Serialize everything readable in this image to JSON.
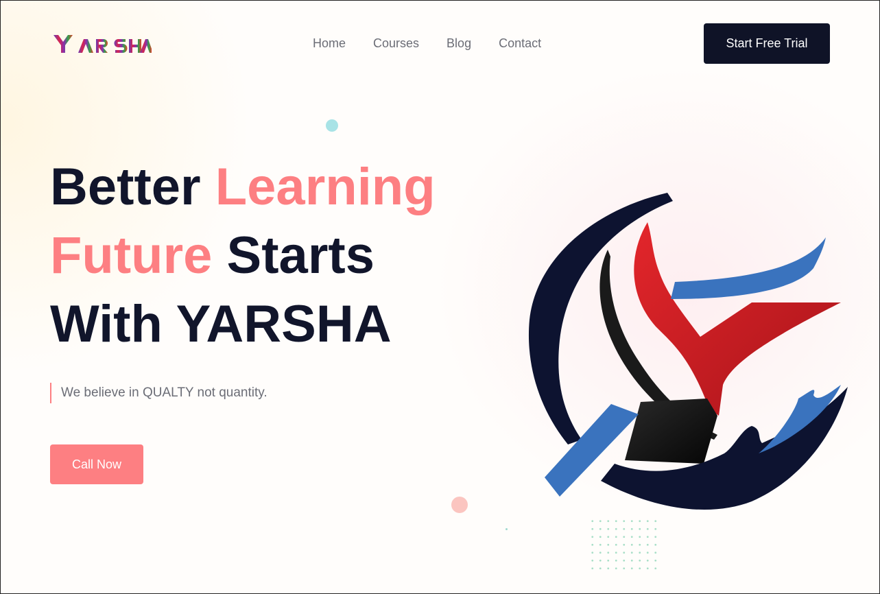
{
  "brand": {
    "name": "YARSHA",
    "logo_icon": "yarsha-logo"
  },
  "nav": {
    "items": [
      {
        "label": "Home"
      },
      {
        "label": "Courses"
      },
      {
        "label": "Blog"
      },
      {
        "label": "Contact"
      }
    ],
    "cta_label": "Start Free Trial"
  },
  "hero": {
    "title_part1": "Better ",
    "title_accent1": "Learning",
    "title_accent2": "Future",
    "title_part2": " Starts",
    "title_part3": "With YARSHA",
    "tagline": "We believe in QUALTY not quantity.",
    "cta_label": "Call Now",
    "emblem_icon": "yarsha-emblem"
  },
  "colors": {
    "accent": "#fd7f82",
    "dark": "#11152b",
    "button_dark": "#0f1327",
    "text_muted": "#6b6d76",
    "emblem_blue": "#3a73be",
    "emblem_red": "#d81e24"
  }
}
